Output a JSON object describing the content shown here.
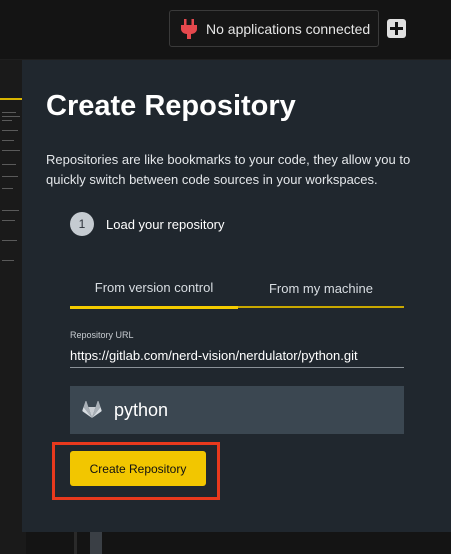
{
  "topbar": {
    "connection_status": "No applications connected",
    "plug_icon": "plug-icon",
    "add_icon": "plus-square-icon"
  },
  "modal": {
    "title": "Create Repository",
    "description": "Repositories are like bookmarks to your code, they allow you to quickly switch between code sources in your workspaces.",
    "step": {
      "number": "1",
      "label": "Load your repository"
    },
    "tabs": [
      {
        "label": "From version control",
        "active": true
      },
      {
        "label": "From my machine",
        "active": false
      }
    ],
    "url_field": {
      "label": "Repository URL",
      "value": "https://gitlab.com/nerd-vision/nerdulator/python.git"
    },
    "repository": {
      "icon": "gitlab-icon",
      "name": "python"
    },
    "create_button": "Create Repository"
  },
  "colors": {
    "accent": "#f2c600",
    "modal_bg": "#20272e",
    "highlight": "#e8391d",
    "plug": "#e5484d"
  }
}
